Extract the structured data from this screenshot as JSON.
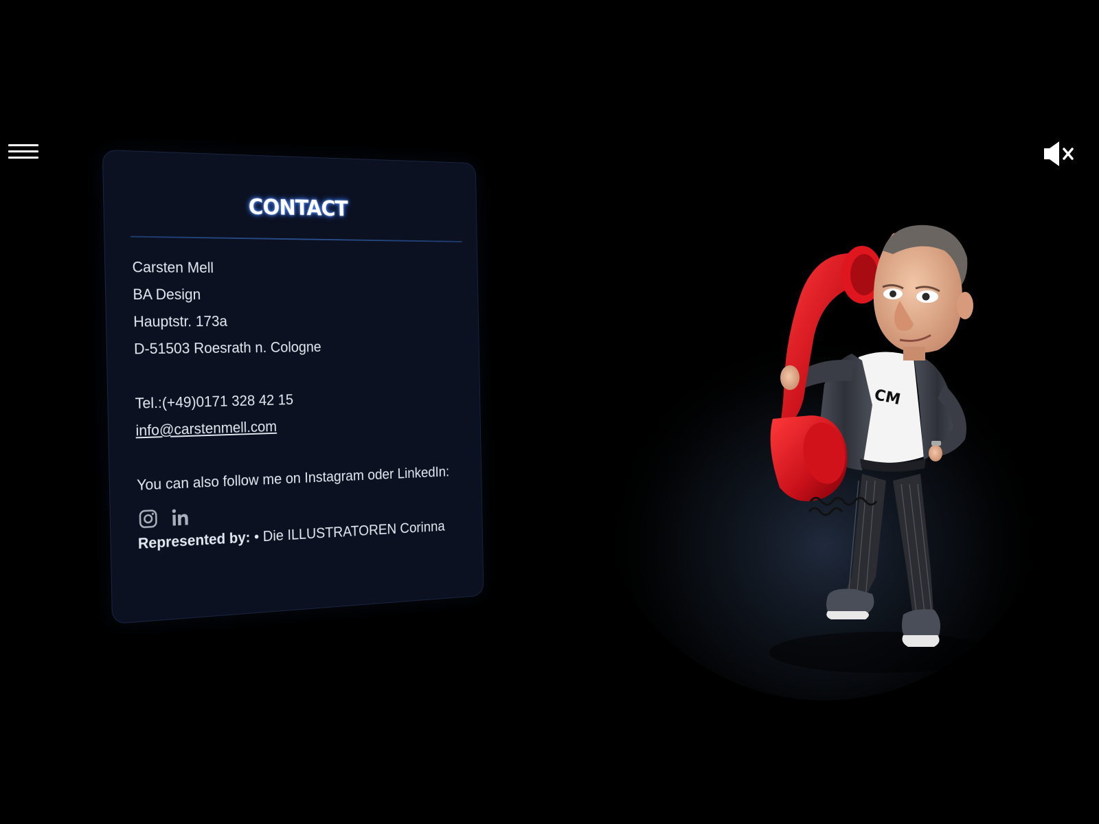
{
  "contact": {
    "title": "CONTACT",
    "name": "Carsten Mell",
    "company": "BA Design",
    "street": "Hauptstr. 173a",
    "city": "D-51503 Roesrath n. Cologne",
    "phone": "Tel.:(+49)0171 328 42 15",
    "email": "info@carstenmell.com",
    "follow_text": "You can also follow me on Instagram oder LinkedIn:",
    "social": {
      "instagram_icon": "instagram-icon",
      "linkedin_icon": "linkedin-icon"
    },
    "represented_label": "Represented by:",
    "represented_value": "• Die ILLUSTRATOREN Corinna"
  },
  "header": {
    "menu_icon": "hamburger-menu-icon",
    "sound_icon": "speaker-muted-icon"
  },
  "figure": {
    "shirt_logo": "CM"
  },
  "colors": {
    "background": "#000000",
    "card": "#0b1120",
    "title_glow": "#4a7fe8",
    "phone_red": "#d3141b"
  }
}
